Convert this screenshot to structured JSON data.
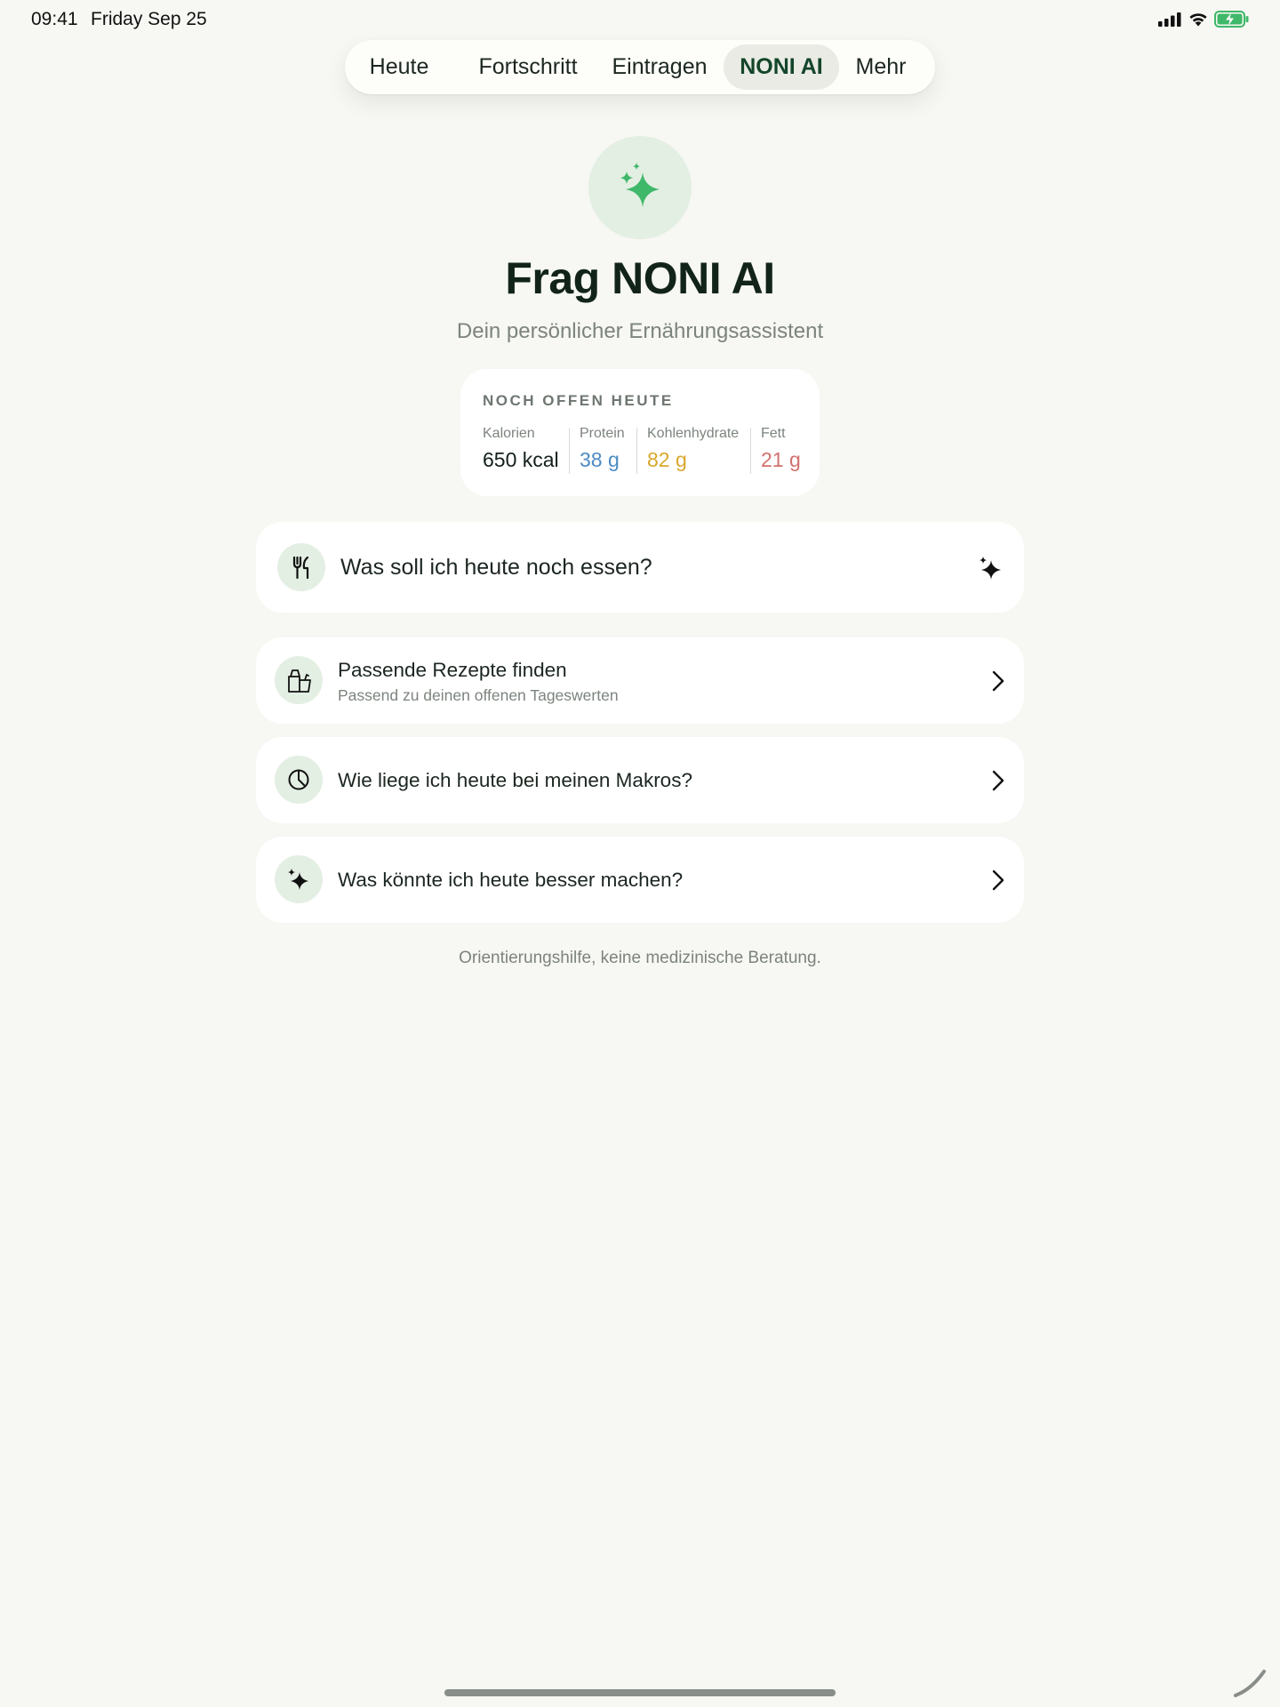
{
  "status_bar": {
    "time": "09:41",
    "date": "Friday Sep 25",
    "icons": [
      "signal-icon",
      "wifi-icon",
      "battery-charging-icon"
    ]
  },
  "nav": {
    "tabs": [
      {
        "label": "Heute",
        "active": false
      },
      {
        "label": "Fortschritt",
        "active": false
      },
      {
        "label": "Eintragen",
        "active": false
      },
      {
        "label": "NONI AI",
        "active": true
      },
      {
        "label": "Mehr",
        "active": false
      }
    ]
  },
  "hero": {
    "icon": "sparkles-icon",
    "title": "Frag NONI AI",
    "subtitle": "Dein persönlicher Ernährungsassistent"
  },
  "remaining": {
    "heading": "NOCH OFFEN HEUTE",
    "macros": [
      {
        "label": "Kalorien",
        "value": "650 kcal",
        "color": "#14201a"
      },
      {
        "label": "Protein",
        "value": "38 g",
        "color": "#4c8bc4"
      },
      {
        "label": "Kohlenhydrate",
        "value": "82 g",
        "color": "#d9a72c"
      },
      {
        "label": "Fett",
        "value": "21 g",
        "color": "#d2716e"
      }
    ]
  },
  "actions": {
    "main": {
      "icon": "fork-knife-icon",
      "label": "Was soll ich heute noch essen?",
      "trailing_icon": "sparkles-icon"
    },
    "items": [
      {
        "icon": "grocery-bag-icon",
        "label": "Passende Rezepte finden",
        "sublabel": "Passend zu deinen offenen Tageswerten"
      },
      {
        "icon": "pie-chart-icon",
        "label": "Wie liege ich heute bei meinen Makros?"
      },
      {
        "icon": "sparkles-icon",
        "label": "Was könnte ich heute besser machen?"
      }
    ]
  },
  "disclaimer": "Orientierungshilfe, keine medizinische Beratung.",
  "colors": {
    "background": "#f7f7f3",
    "accent_green": "#3fb86a",
    "icon_circle": "#e3efe3",
    "active_tab_text": "#14452a"
  }
}
